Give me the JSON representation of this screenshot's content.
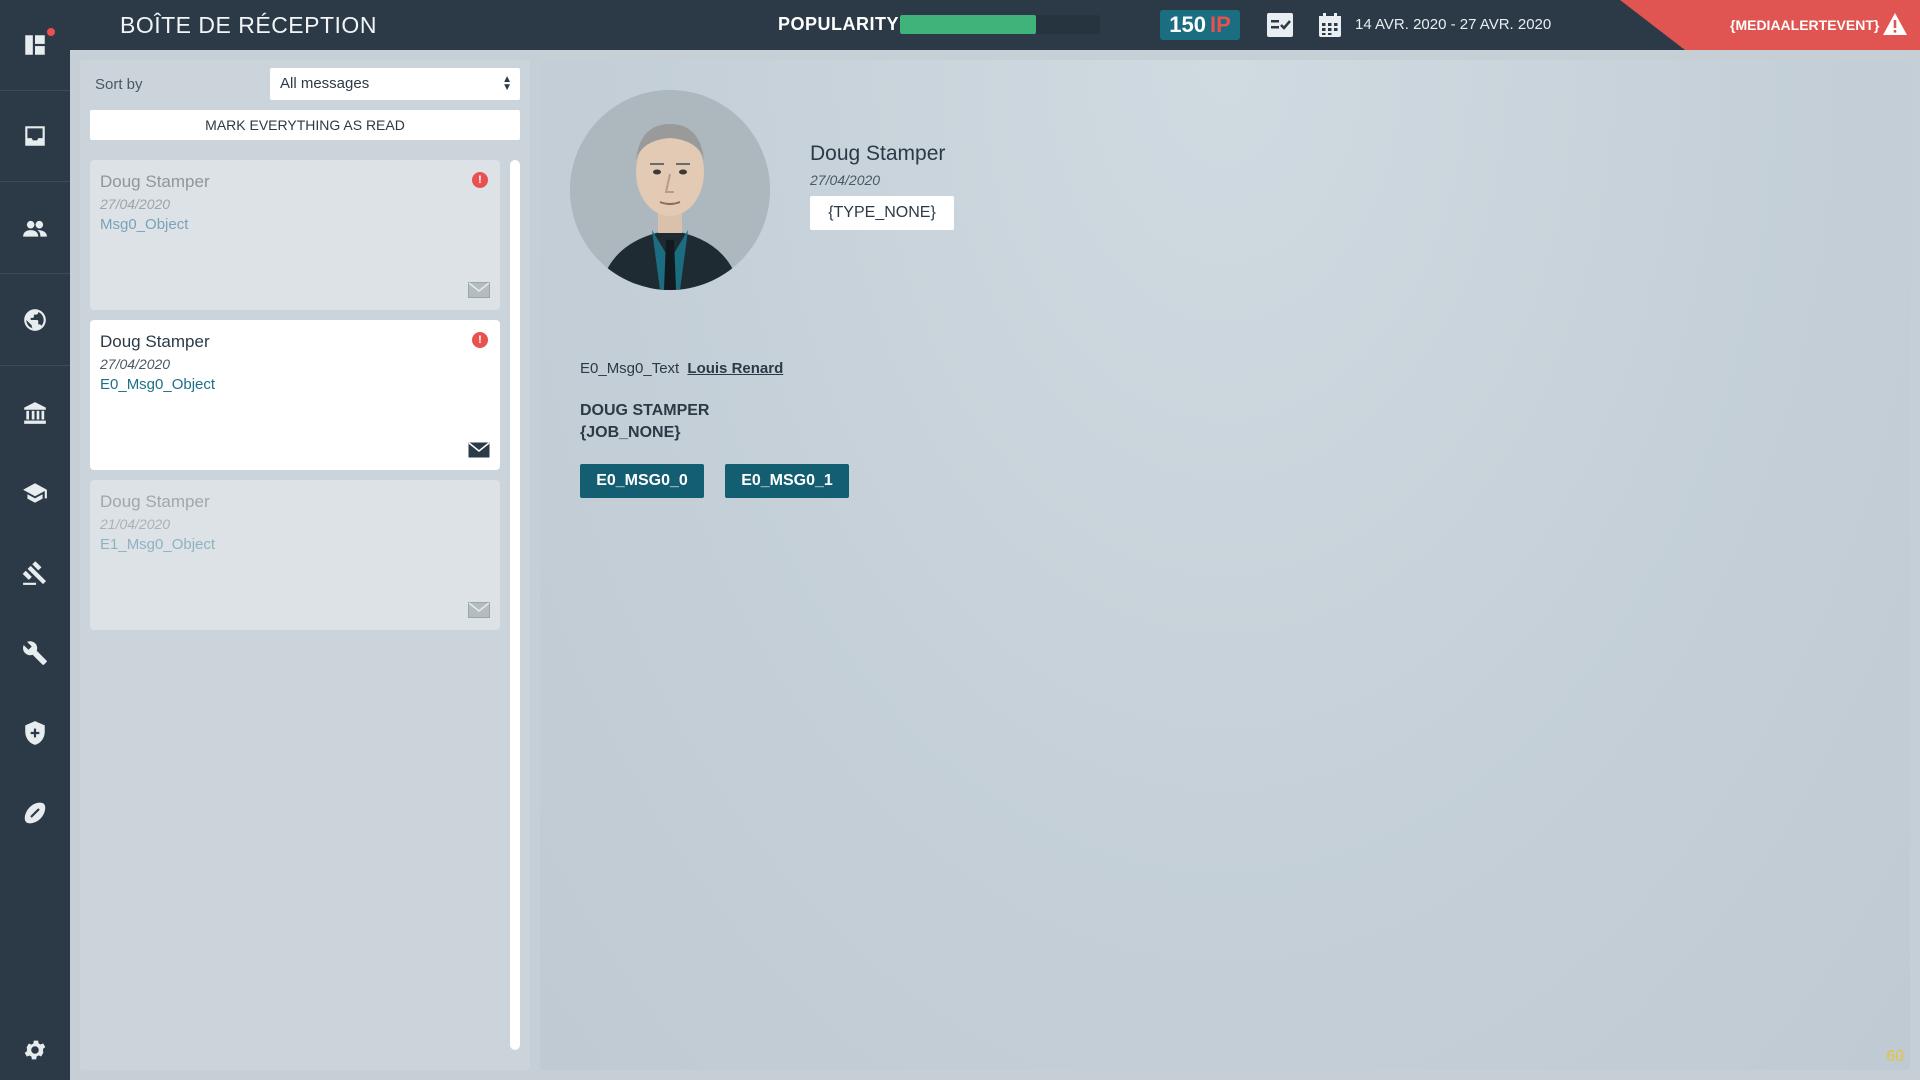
{
  "header": {
    "title": "BOÎTE DE RÉCEPTION",
    "popularity_label": "POPULARITY",
    "popularity_value": 0.68,
    "ip_value": "150",
    "ip_unit": "IP",
    "date_range": "14 AVR. 2020 - 27 AVR. 2020",
    "alert_text": "{MEDIAALERTEVENT}"
  },
  "sidebar": {
    "items": [
      {
        "icon": "dashboard-icon",
        "active": false
      },
      {
        "icon": "inbox-icon",
        "active": true
      },
      {
        "icon": "people-icon",
        "active": false
      },
      {
        "icon": "globe-icon",
        "active": false
      },
      {
        "icon": "institution-icon",
        "active": false
      },
      {
        "icon": "education-icon",
        "active": false
      },
      {
        "icon": "gavel-icon",
        "active": false
      },
      {
        "icon": "tools-icon",
        "active": false
      },
      {
        "icon": "shield-icon",
        "active": false
      },
      {
        "icon": "sports-icon",
        "active": false
      },
      {
        "icon": "settings-icon",
        "active": false
      }
    ]
  },
  "inbox": {
    "sort_label": "Sort by",
    "sort_value": "All messages",
    "mark_all_label": "MARK EVERYTHING AS READ",
    "messages": [
      {
        "sender": "Doug Stamper",
        "date": "27/04/2020",
        "subject": "Msg0_Object",
        "state": "read",
        "unread_mark": "!"
      },
      {
        "sender": "Doug Stamper",
        "date": "27/04/2020",
        "subject": "E0_Msg0_Object",
        "state": "active",
        "unread_mark": "!"
      },
      {
        "sender": "Doug Stamper",
        "date": "21/04/2020",
        "subject": "E1_Msg0_Object",
        "state": "faded",
        "unread_mark": ""
      }
    ]
  },
  "detail": {
    "sender": "Doug Stamper",
    "date": "27/04/2020",
    "type": "{TYPE_NONE}",
    "body_text": "E0_Msg0_Text",
    "body_link": "Louis Renard",
    "signature_name": "DOUG STAMPER",
    "signature_job": "{JOB_NONE}",
    "actions": [
      "E0_MSG0_0",
      "E0_MSG0_1"
    ]
  },
  "fps": "60",
  "colors": {
    "sidebar_bg": "#2b3a46",
    "accent_teal": "#135e70",
    "alert_red": "#e05451",
    "popularity_green": "#3fb37a"
  }
}
